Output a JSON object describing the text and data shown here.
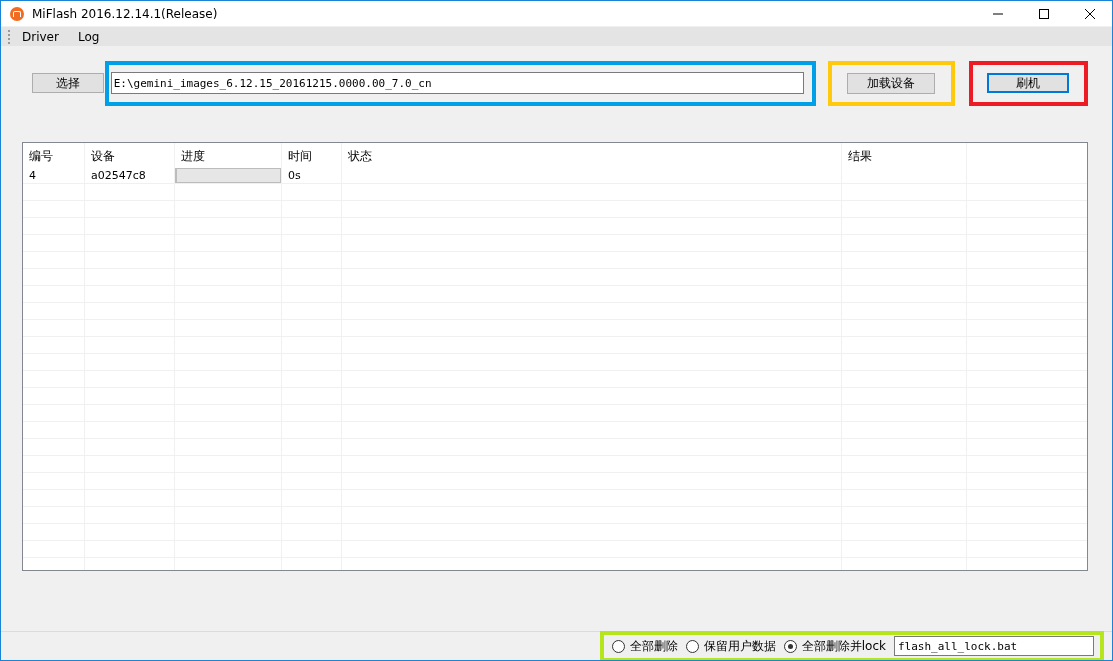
{
  "window": {
    "title": "MiFlash 2016.12.14.1(Release)"
  },
  "menu": [
    "Driver",
    "Log"
  ],
  "select_button": "选择",
  "path_field": {
    "value": "E:\\gemini_images_6.12.15_20161215.0000.00_7.0_cn"
  },
  "load_button": "加载设备",
  "flash_button": "刷机",
  "table": {
    "columns": [
      "编号",
      "设备",
      "进度",
      "时间",
      "状态",
      "结果"
    ],
    "rows": [
      {
        "number": "4",
        "device": "a02547c8",
        "level": 0,
        "time": "0s",
        "status": "",
        "result": ""
      }
    ]
  },
  "options": [
    {
      "label": "全部删除",
      "selected": false
    },
    {
      "label": "保留用户数据",
      "selected": false
    },
    {
      "label": "全部删除并lock",
      "selected": true
    }
  ],
  "script_field": {
    "value": "flash_all_lock.bat"
  }
}
